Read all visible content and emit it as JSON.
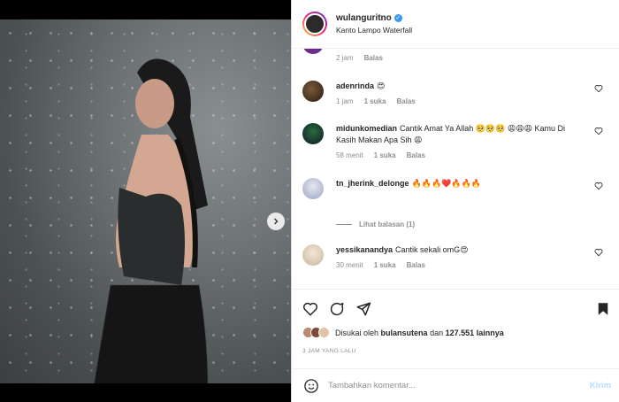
{
  "header": {
    "username": "wulanguritno",
    "location": "Kanto Lampo Waterfall",
    "more": "···"
  },
  "comments": [
    {
      "username": "",
      "text": "",
      "time": "2 jam",
      "likes": "",
      "reply": "Balas"
    },
    {
      "username": "adenrinda",
      "text": "😍",
      "time": "1 jam",
      "likes": "1 suka",
      "reply": "Balas"
    },
    {
      "username": "midunkomedian",
      "text": "Cantik Amat Ya Allah 🥺🥺🥺 😩😩😩 Kamu Di Kasih Makan Apa Sih 😩",
      "time": "58 menit",
      "likes": "1 suka",
      "reply": "Balas"
    },
    {
      "username": "tn_jherink_delonge",
      "text": "🔥🔥🔥❤️🔥🔥🔥",
      "time": "",
      "likes": "",
      "reply": ""
    },
    {
      "username": "yessikanandya",
      "text": "Cantik sekali omG😍",
      "time": "30 menit",
      "likes": "1 suka",
      "reply": "Balas"
    }
  ],
  "view_replies": "Lihat balasan (1)",
  "likes": {
    "prefix": "Disukai oleh",
    "user": "bulansutena",
    "middle": "dan",
    "count": "127.551",
    "suffix": "lainnya"
  },
  "timestamp": "3 JAM YANG LALU",
  "composer": {
    "placeholder": "Tambahkan komentar...",
    "send": "Kirim"
  },
  "colors": {
    "verified": "#3897f0",
    "carousel_active_dot": "#3b82f6",
    "send_disabled": "#b2dffc"
  }
}
